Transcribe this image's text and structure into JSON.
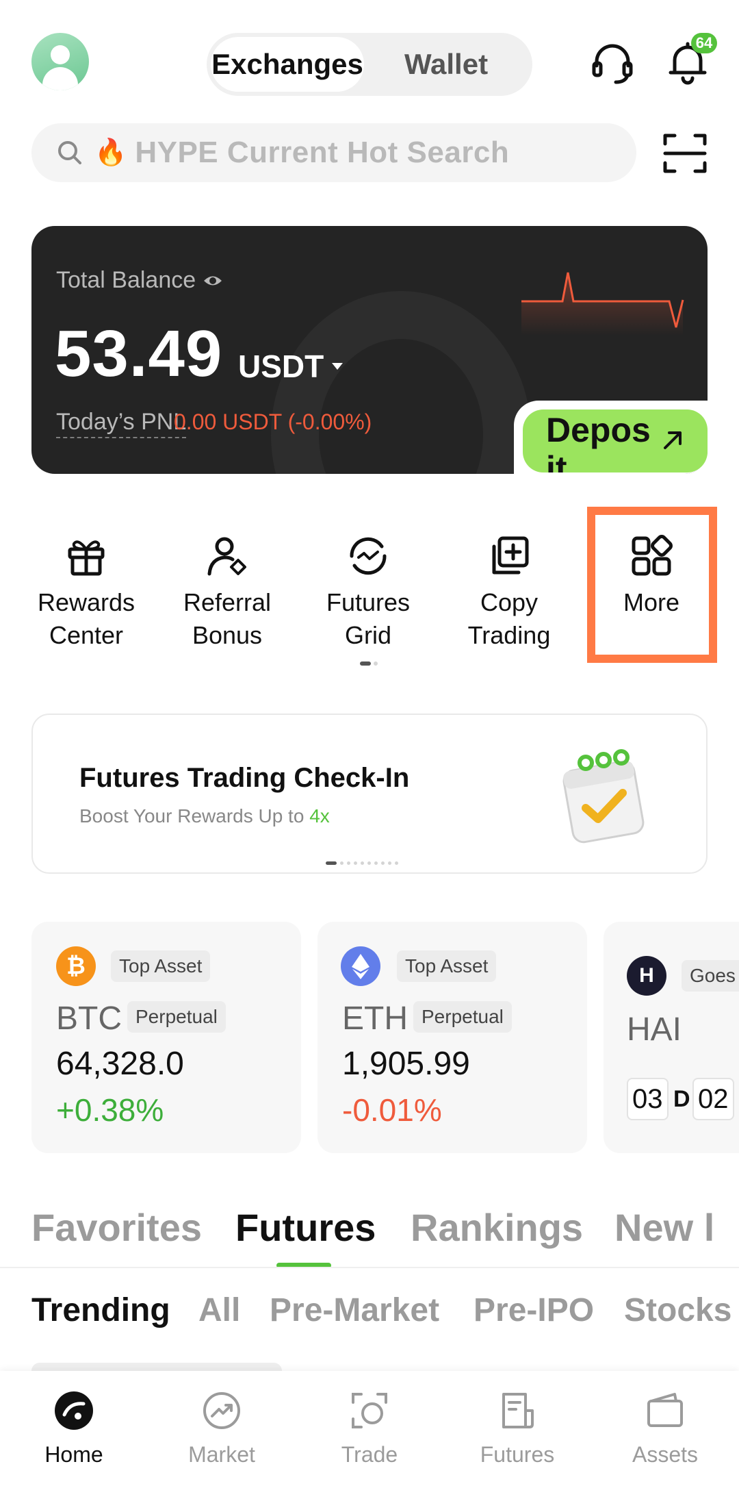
{
  "header": {
    "tabs": [
      {
        "label": "Exchanges",
        "active": true
      },
      {
        "label": "Wallet",
        "active": false
      }
    ],
    "notification_count": "64"
  },
  "search": {
    "placeholder": "HYPE Current Hot Search"
  },
  "balance": {
    "label": "Total Balance",
    "value": "53.49",
    "unit": "USDT",
    "pnl_label": "Today’s PNL",
    "pnl_value": "0.00 USDT (-0.00%)",
    "deposit_label": "Deposit"
  },
  "quick_actions": [
    {
      "label": "Rewards\nCenter",
      "icon": "gift-icon"
    },
    {
      "label": "Referral\nBonus",
      "icon": "referral-icon"
    },
    {
      "label": "Futures\nGrid",
      "icon": "grid-bot-icon"
    },
    {
      "label": "Copy\nTrading",
      "icon": "copy-trading-icon"
    },
    {
      "label": "More",
      "icon": "apps-icon"
    }
  ],
  "banner": {
    "title": "Futures Trading Check-In",
    "subtitle_prefix": "Boost Your Rewards Up to ",
    "subtitle_highlight": "4x"
  },
  "assets": [
    {
      "tag": "Top Asset",
      "symbol": "BTC",
      "type": "Perpetual",
      "price": "64,328.0",
      "change": "+0.38%",
      "direction": "up",
      "coin_color": "#f7931a"
    },
    {
      "tag": "Top Asset",
      "symbol": "ETH",
      "type": "Perpetual",
      "price": "1,905.99",
      "change": "-0.01%",
      "direction": "down",
      "coin_color": "#627eea"
    },
    {
      "tag": "Goes",
      "symbol": "HAI",
      "countdown_days": "03",
      "countdown_unit": "D",
      "countdown_hours": "02",
      "coin_color": "#1b1b2f"
    }
  ],
  "market_tabs": [
    {
      "label": "Favorites",
      "active": false
    },
    {
      "label": "Futures",
      "active": true
    },
    {
      "label": "Rankings",
      "active": false
    },
    {
      "label": "New l",
      "active": false
    }
  ],
  "sub_tabs": [
    {
      "label": "Trending",
      "active": true
    },
    {
      "label": "All",
      "active": false
    },
    {
      "label": "Pre-Market",
      "active": false
    },
    {
      "label": "Pre-IPO",
      "active": false
    },
    {
      "label": "Stocks",
      "active": false
    }
  ],
  "bottom_nav": [
    {
      "label": "Home",
      "active": true
    },
    {
      "label": "Market",
      "active": false
    },
    {
      "label": "Trade",
      "active": false
    },
    {
      "label": "Futures",
      "active": false
    },
    {
      "label": "Assets",
      "active": false
    }
  ],
  "colors": {
    "accent": "#9be45e",
    "up": "#3dae3a",
    "down": "#ef5b3c",
    "highlight_box": "#ff7a45"
  }
}
